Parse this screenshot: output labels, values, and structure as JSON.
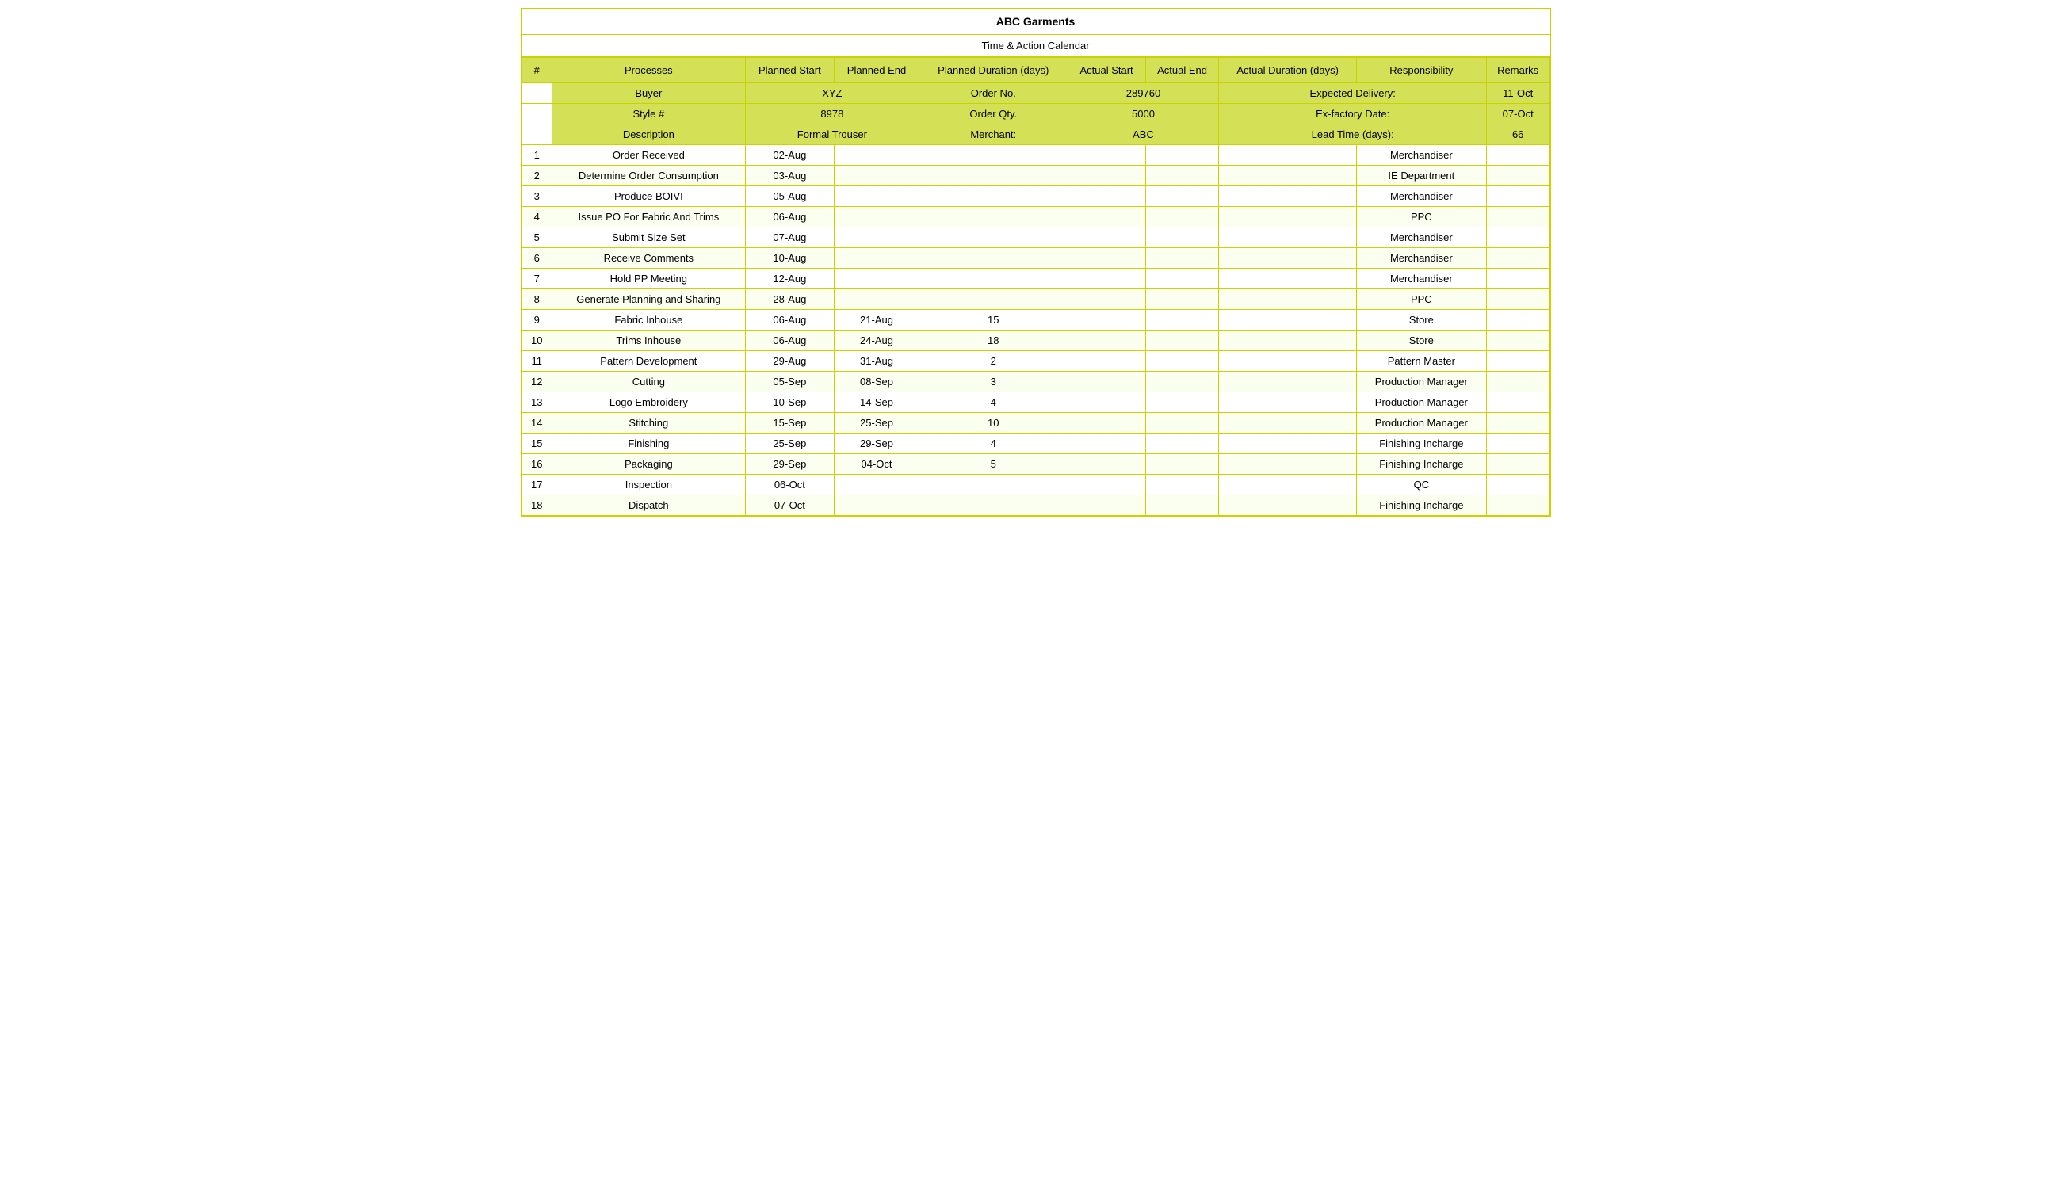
{
  "title": "ABC Garments",
  "subtitle": "Time & Action Calendar",
  "infoRows": [
    {
      "label1": "Buyer",
      "value1": "XYZ",
      "label2": "Order No.",
      "value2": "289760",
      "label3": "Expected Delivery:",
      "value3": "11-Oct"
    },
    {
      "label1": "Style #",
      "value1": "8978",
      "label2": "Order Qty.",
      "value2": "5000",
      "label3": "Ex-factory Date:",
      "value3": "07-Oct"
    },
    {
      "label1": "Description",
      "value1": "Formal Trouser",
      "label2": "Merchant:",
      "value2": "ABC",
      "label3": "Lead Time (days):",
      "value3": "66"
    }
  ],
  "columns": {
    "num": "#",
    "process": "Processes",
    "plannedStart": "Planned Start",
    "plannedEnd": "Planned End",
    "plannedDuration": "Planned Duration (days)",
    "actualStart": "Actual Start",
    "actualEnd": "Actual End",
    "actualDuration": "Actual Duration (days)",
    "responsibility": "Responsibility",
    "remarks": "Remarks"
  },
  "rows": [
    {
      "num": "1",
      "process": "Order Received",
      "plannedStart": "02-Aug",
      "plannedEnd": "",
      "plannedDuration": "",
      "actualStart": "",
      "actualEnd": "",
      "actualDuration": "",
      "responsibility": "Merchandiser",
      "remarks": ""
    },
    {
      "num": "2",
      "process": "Determine Order Consumption",
      "plannedStart": "03-Aug",
      "plannedEnd": "",
      "plannedDuration": "",
      "actualStart": "",
      "actualEnd": "",
      "actualDuration": "",
      "responsibility": "IE Department",
      "remarks": ""
    },
    {
      "num": "3",
      "process": "Produce BOIVI",
      "plannedStart": "05-Aug",
      "plannedEnd": "",
      "plannedDuration": "",
      "actualStart": "",
      "actualEnd": "",
      "actualDuration": "",
      "responsibility": "Merchandiser",
      "remarks": ""
    },
    {
      "num": "4",
      "process": "Issue PO For Fabric And Trims",
      "plannedStart": "06-Aug",
      "plannedEnd": "",
      "plannedDuration": "",
      "actualStart": "",
      "actualEnd": "",
      "actualDuration": "",
      "responsibility": "PPC",
      "remarks": ""
    },
    {
      "num": "5",
      "process": "Submit Size Set",
      "plannedStart": "07-Aug",
      "plannedEnd": "",
      "plannedDuration": "",
      "actualStart": "",
      "actualEnd": "",
      "actualDuration": "",
      "responsibility": "Merchandiser",
      "remarks": ""
    },
    {
      "num": "6",
      "process": "Receive Comments",
      "plannedStart": "10-Aug",
      "plannedEnd": "",
      "plannedDuration": "",
      "actualStart": "",
      "actualEnd": "",
      "actualDuration": "",
      "responsibility": "Merchandiser",
      "remarks": ""
    },
    {
      "num": "7",
      "process": "Hold PP Meeting",
      "plannedStart": "12-Aug",
      "plannedEnd": "",
      "plannedDuration": "",
      "actualStart": "",
      "actualEnd": "",
      "actualDuration": "",
      "responsibility": "Merchandiser",
      "remarks": ""
    },
    {
      "num": "8",
      "process": "Generate Planning and Sharing",
      "plannedStart": "28-Aug",
      "plannedEnd": "",
      "plannedDuration": "",
      "actualStart": "",
      "actualEnd": "",
      "actualDuration": "",
      "responsibility": "PPC",
      "remarks": ""
    },
    {
      "num": "9",
      "process": "Fabric Inhouse",
      "plannedStart": "06-Aug",
      "plannedEnd": "21-Aug",
      "plannedDuration": "15",
      "actualStart": "",
      "actualEnd": "",
      "actualDuration": "",
      "responsibility": "Store",
      "remarks": ""
    },
    {
      "num": "10",
      "process": "Trims Inhouse",
      "plannedStart": "06-Aug",
      "plannedEnd": "24-Aug",
      "plannedDuration": "18",
      "actualStart": "",
      "actualEnd": "",
      "actualDuration": "",
      "responsibility": "Store",
      "remarks": ""
    },
    {
      "num": "11",
      "process": "Pattern Development",
      "plannedStart": "29-Aug",
      "plannedEnd": "31-Aug",
      "plannedDuration": "2",
      "actualStart": "",
      "actualEnd": "",
      "actualDuration": "",
      "responsibility": "Pattern Master",
      "remarks": ""
    },
    {
      "num": "12",
      "process": "Cutting",
      "plannedStart": "05-Sep",
      "plannedEnd": "08-Sep",
      "plannedDuration": "3",
      "actualStart": "",
      "actualEnd": "",
      "actualDuration": "",
      "responsibility": "Production Manager",
      "remarks": ""
    },
    {
      "num": "13",
      "process": "Logo Embroidery",
      "plannedStart": "10-Sep",
      "plannedEnd": "14-Sep",
      "plannedDuration": "4",
      "actualStart": "",
      "actualEnd": "",
      "actualDuration": "",
      "responsibility": "Production Manager",
      "remarks": ""
    },
    {
      "num": "14",
      "process": "Stitching",
      "plannedStart": "15-Sep",
      "plannedEnd": "25-Sep",
      "plannedDuration": "10",
      "actualStart": "",
      "actualEnd": "",
      "actualDuration": "",
      "responsibility": "Production Manager",
      "remarks": ""
    },
    {
      "num": "15",
      "process": "Finishing",
      "plannedStart": "25-Sep",
      "plannedEnd": "29-Sep",
      "plannedDuration": "4",
      "actualStart": "",
      "actualEnd": "",
      "actualDuration": "",
      "responsibility": "Finishing Incharge",
      "remarks": ""
    },
    {
      "num": "16",
      "process": "Packaging",
      "plannedStart": "29-Sep",
      "plannedEnd": "04-Oct",
      "plannedDuration": "5",
      "actualStart": "",
      "actualEnd": "",
      "actualDuration": "",
      "responsibility": "Finishing Incharge",
      "remarks": ""
    },
    {
      "num": "17",
      "process": "Inspection",
      "plannedStart": "06-Oct",
      "plannedEnd": "",
      "plannedDuration": "",
      "actualStart": "",
      "actualEnd": "",
      "actualDuration": "",
      "responsibility": "QC",
      "remarks": ""
    },
    {
      "num": "18",
      "process": "Dispatch",
      "plannedStart": "07-Oct",
      "plannedEnd": "",
      "plannedDuration": "",
      "actualStart": "",
      "actualEnd": "",
      "actualDuration": "",
      "responsibility": "Finishing Incharge",
      "remarks": ""
    }
  ]
}
